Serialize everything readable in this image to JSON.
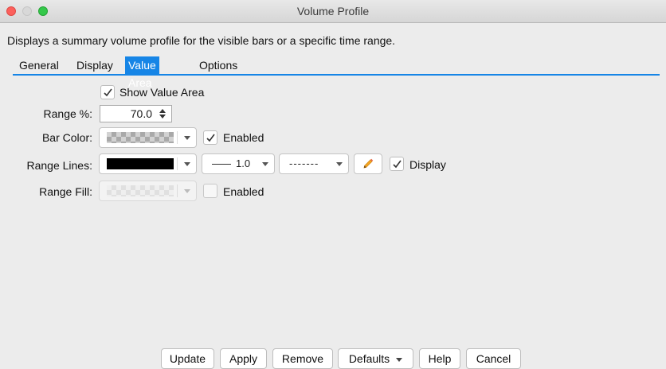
{
  "window": {
    "title": "Volume Profile"
  },
  "description": "Displays a summary volume profile for the visible bars or a specific time range.",
  "tabs": [
    {
      "label": "General",
      "active": false
    },
    {
      "label": "Display",
      "active": false
    },
    {
      "label": "Value Area",
      "active": true
    },
    {
      "label": "Options",
      "active": false
    }
  ],
  "accent_color": "#1685e6",
  "form": {
    "show_value_area": {
      "label": "Show Value Area",
      "checked": true
    },
    "range_percent": {
      "label": "Range %:",
      "value": "70.0"
    },
    "bar_color": {
      "label": "Bar Color:",
      "enabled_label": "Enabled",
      "enabled_checked": true
    },
    "range_lines": {
      "label": "Range Lines:",
      "color": "#000000",
      "width": "1.0",
      "style": "-------",
      "edit_icon": "pencil-icon",
      "display_label": "Display",
      "display_checked": true
    },
    "range_fill": {
      "label": "Range Fill:",
      "enabled_label": "Enabled",
      "enabled_checked": false
    }
  },
  "buttons": {
    "update": "Update",
    "apply": "Apply",
    "remove": "Remove",
    "defaults": "Defaults",
    "help": "Help",
    "cancel": "Cancel"
  }
}
